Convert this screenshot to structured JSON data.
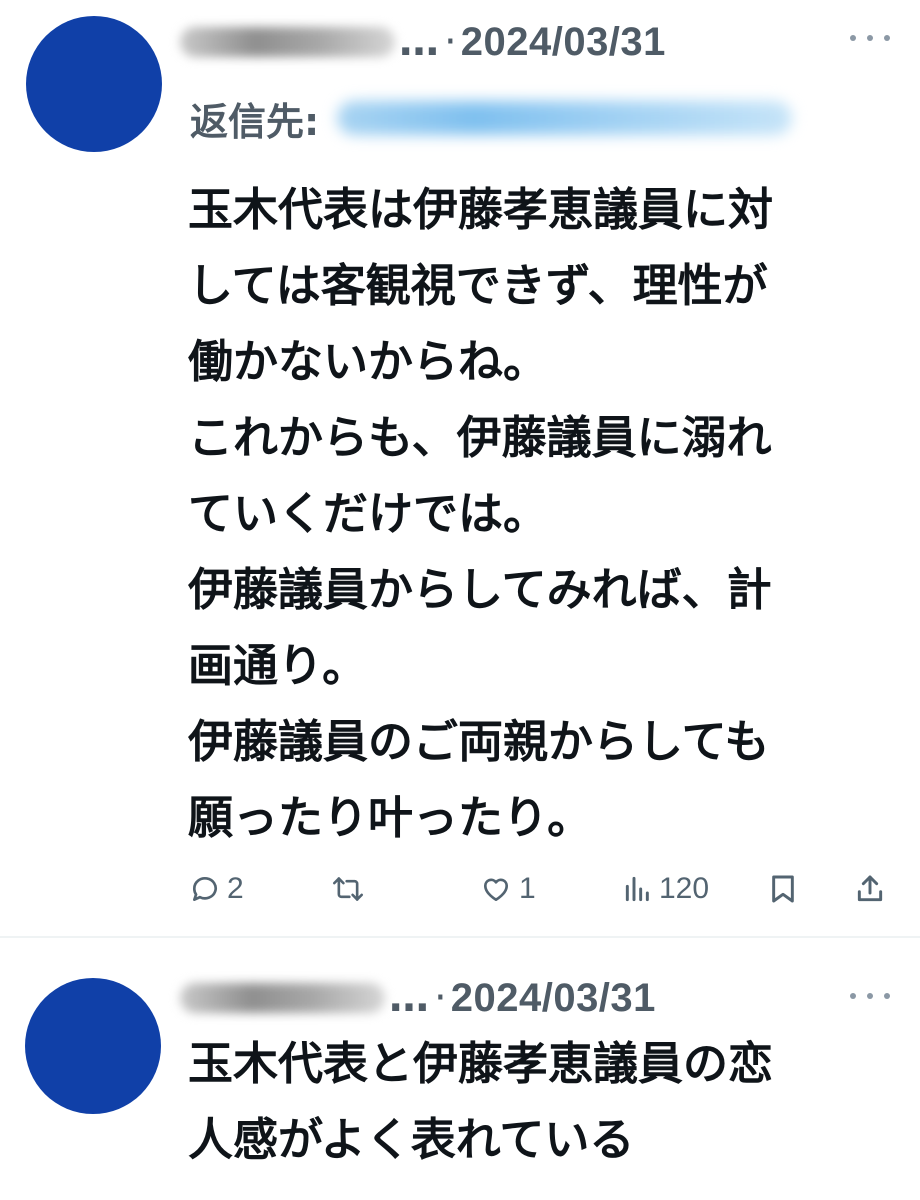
{
  "tweets": [
    {
      "ellipsis": "…",
      "separator": "·",
      "date": "2024/03/31",
      "reply_label": "返信先:",
      "body_lines": [
        "玉木代表は伊藤孝恵議員に対",
        "しては客観視できず、理性が",
        "働かないからね。",
        "これからも、伊藤議員に溺れ",
        "ていくだけでは。",
        "伊藤議員からしてみれば、計",
        "画通り。",
        "伊藤議員のご両親からしても",
        "願ったり叶ったり。"
      ],
      "actions": {
        "reply_count": "2",
        "retweet_count": "",
        "like_count": "1",
        "views_count": "120"
      }
    },
    {
      "ellipsis": "…",
      "separator": "·",
      "date": "2024/03/31",
      "body_lines": [
        "玉木代表と伊藤孝恵議員の恋",
        "人感がよく表れている"
      ]
    }
  ],
  "colors": {
    "avatar": "#1040a8",
    "text_primary": "#0f1419",
    "text_secondary": "#4f5b66",
    "icon": "#536471",
    "reply_blur": "#7fc0ef"
  },
  "icons": {
    "reply": "speech-bubble-icon",
    "retweet": "retweet-arrows-icon",
    "like": "heart-icon",
    "views": "bar-chart-icon",
    "bookmark": "bookmark-icon",
    "share": "share-upload-icon",
    "more": "more-dots-icon"
  }
}
